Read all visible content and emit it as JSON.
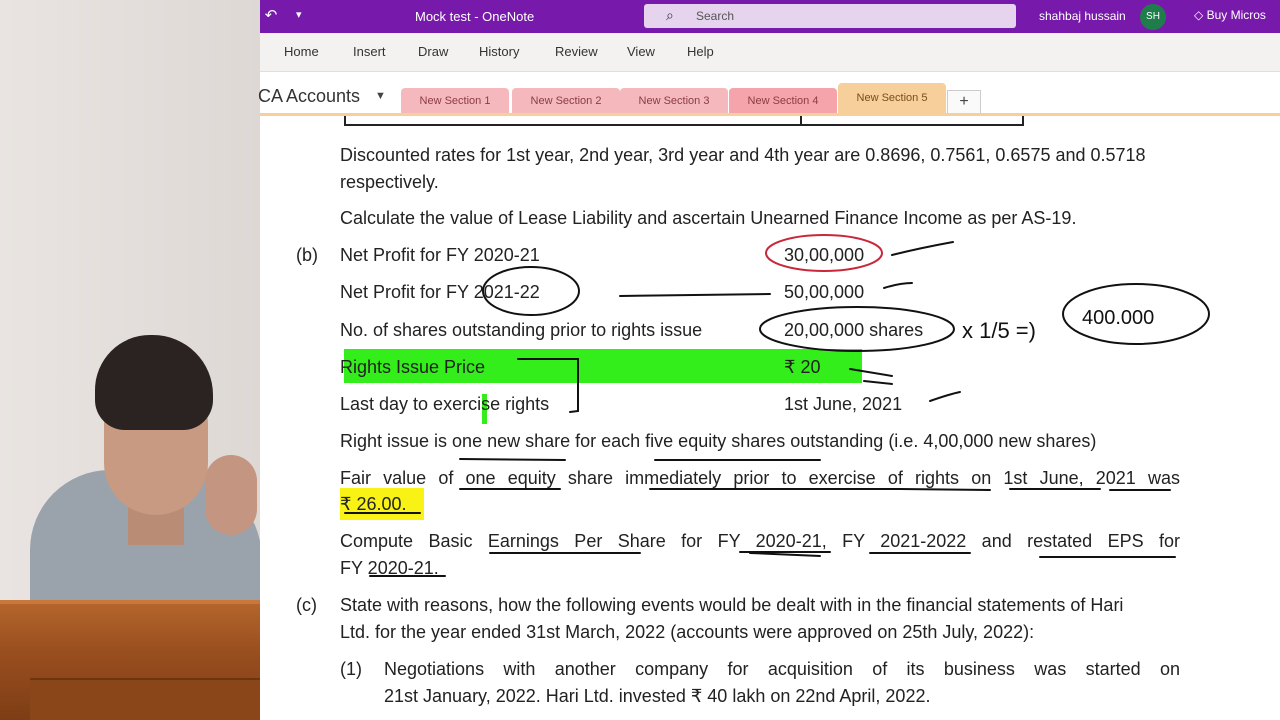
{
  "window": {
    "title": "Mock test  -  OneNote",
    "search_placeholder": "Search",
    "user_name": "shahbaj hussain",
    "user_initials": "SH",
    "buy_label": "Buy Micros"
  },
  "ribbon": {
    "tabs": [
      "Home",
      "Insert",
      "Draw",
      "History",
      "Review",
      "View",
      "Help"
    ]
  },
  "notebook": {
    "name": "CA Accounts",
    "sections": [
      "New Section 1",
      "New Section 2",
      "New Section 3",
      "New Section 4",
      "New Section 5"
    ],
    "active_section": "New Section 5",
    "add_label": "+"
  },
  "colors": {
    "titlebar": "#7719aa",
    "highlight_green": "#33ee1a",
    "highlight_yellow": "#f8f314",
    "ink_red": "#c8283a"
  },
  "content": {
    "discount_line1": "Discounted rates for 1st year, 2nd year, 3rd year and 4th year are 0.8696, 0.7561, 0.6575 and 0.5718",
    "discount_line2": "respectively.",
    "calculate": "Calculate the value of Lease Liability and ascertain Unearned Finance Income as per AS-19.",
    "b_label": "(b)",
    "rows": [
      {
        "label": "Net Profit for FY 2020-21",
        "value": "30,00,000"
      },
      {
        "label": "Net Profit for FY 2021-22",
        "value": "50,00,000"
      },
      {
        "label": "No. of shares outstanding prior to rights issue",
        "value": "20,00,000 shares"
      },
      {
        "label": "Rights Issue Price",
        "value": "₹ 20"
      },
      {
        "label": "Last day to exercise rights",
        "value": "1st June, 2021"
      }
    ],
    "right_issue": "Right issue is one new share for each five equity shares outstanding (i.e. 4,00,000 new shares)",
    "fair_value_line1": "Fair value of one equity share immediately prior to exercise of rights on 1st June, 2021 was",
    "fair_value_line2": "₹ 26.00.",
    "compute_line1": "Compute Basic Earnings Per Share for FY 2020-21, FY 2021-2022 and restated EPS for",
    "compute_line2": "FY 2020-21.",
    "c_label": "(c)",
    "c_line1": "State with reasons, how the following events would be dealt with in the financial statements of Hari",
    "c_line2": "Ltd. for the year ended 31st March, 2022 (accounts were approved on 25th July, 2022):",
    "item1_label": "(1)",
    "item1_line1": "Negotiations with another company for acquisition of its business was started on",
    "item1_line2": "21st January, 2022. Hari Ltd. invested ₹ 40 lakh on 22nd April, 2022.",
    "annotation_multiplier": "x 1/5 =)",
    "annotation_result": "400.000"
  }
}
